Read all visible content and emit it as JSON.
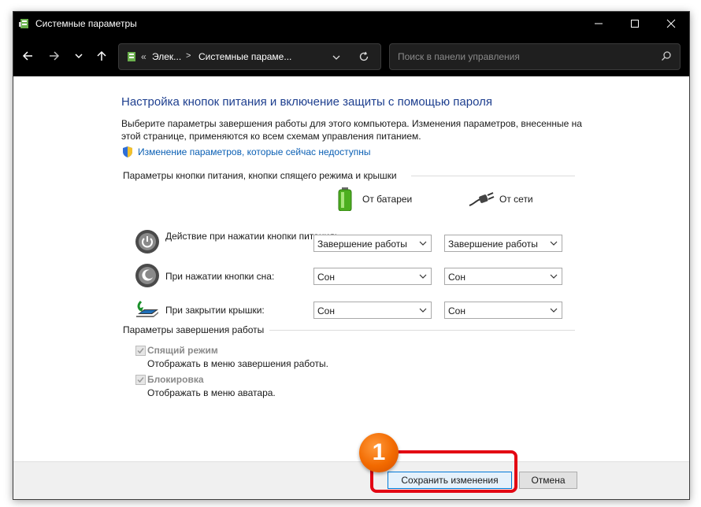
{
  "window": {
    "title": "Системные параметры"
  },
  "nav": {
    "breadcrumb_prefix": "«",
    "breadcrumb_1": "Элек...",
    "breadcrumb_sep": ">",
    "breadcrumb_2": "Системные параме...",
    "search_placeholder": "Поиск в панели управления"
  },
  "main": {
    "heading": "Настройка кнопок питания и включение защиты с помощью пароля",
    "description": "Выберите параметры завершения работы для этого компьютера. Изменения параметров, внесенные на этой странице, применяются ко всем схемам управления питанием.",
    "unavailable_link": "Изменение параметров, которые сейчас недоступны",
    "buttons_section": "Параметры кнопки питания, кнопки спящего режима и крышки",
    "col_battery": "От батареи",
    "col_ac": "От сети",
    "rows": [
      {
        "label": "Действие при нажатии кнопки питания:",
        "battery": "Завершение работы",
        "ac": "Завершение работы"
      },
      {
        "label": "При нажатии кнопки сна:",
        "battery": "Сон",
        "ac": "Сон"
      },
      {
        "label": "При закрытии крышки:",
        "battery": "Сон",
        "ac": "Сон"
      }
    ],
    "shutdown_section": "Параметры завершения работы",
    "options": [
      {
        "label": "Спящий режим",
        "sub": "Отображать в меню завершения работы.",
        "checked": true
      },
      {
        "label": "Блокировка",
        "sub": "Отображать в меню аватара.",
        "checked": true
      }
    ]
  },
  "footer": {
    "save": "Сохранить изменения",
    "cancel": "Отмена"
  },
  "annotation": {
    "step": "1",
    "highlight_color": "#e30613",
    "badge_color": "#f26a00"
  }
}
